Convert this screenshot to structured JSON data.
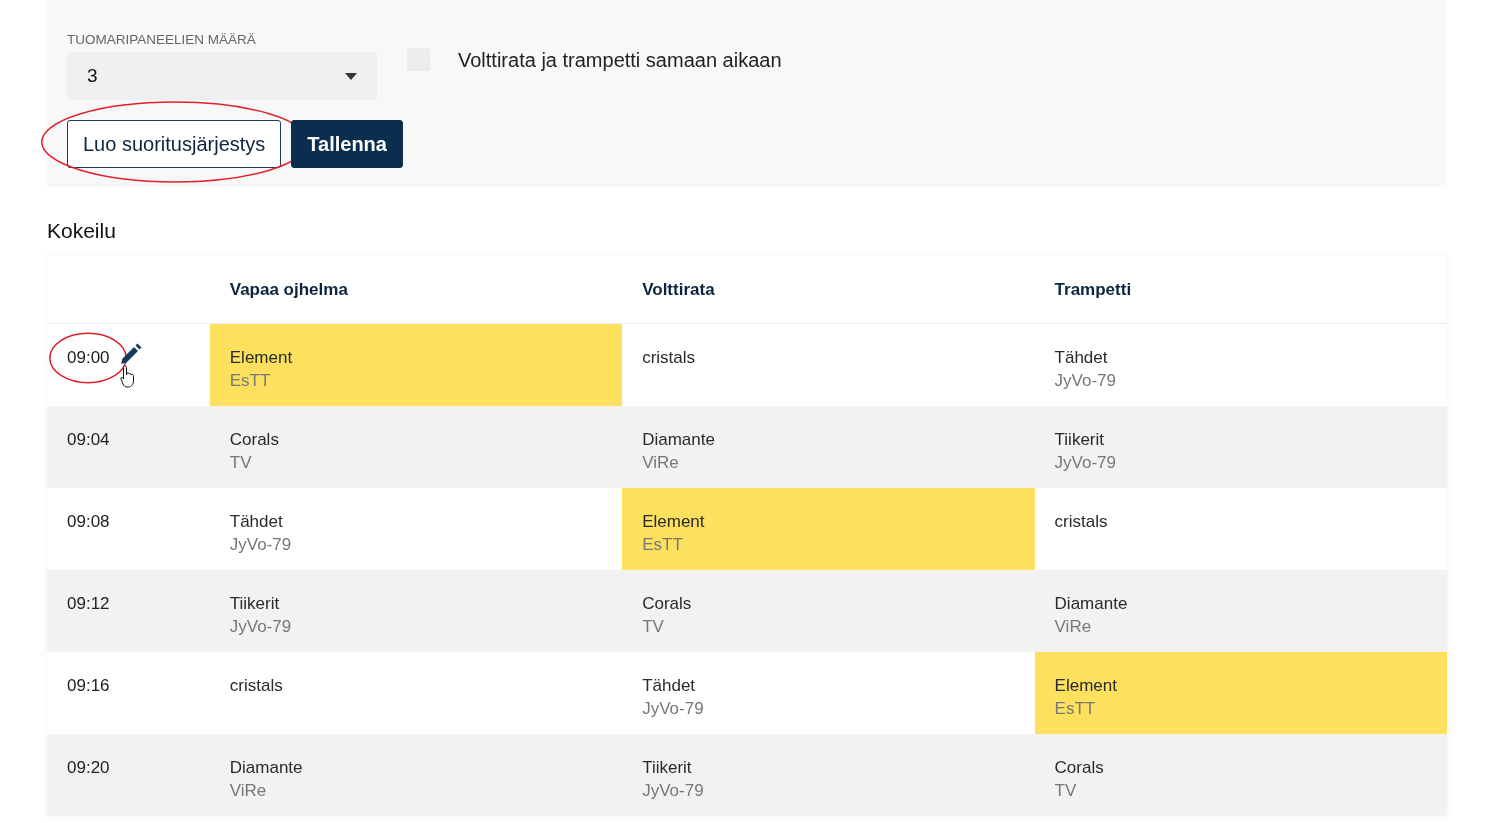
{
  "settings": {
    "judge_panels": {
      "label": "TUOMARIPANEELIEN MÄÄRÄ",
      "value": "3"
    },
    "simultaneous": {
      "label": "Volttirata ja trampetti samaan aikaan",
      "checked": false
    },
    "buttons": [
      {
        "label": "Luo suoritusjärjestys",
        "kind": "outline",
        "circled": true
      },
      {
        "label": "Tallenna",
        "kind": "primary",
        "circled": false
      }
    ]
  },
  "section_title": "Kokeilu",
  "table": {
    "columns": [
      "Vapaa ojhelma",
      "Volttirata",
      "Trampetti"
    ],
    "rows": [
      {
        "time": "09:00",
        "editable": true,
        "circled": true,
        "hovered": true,
        "cells": [
          {
            "team": "Element",
            "club": "EsTT",
            "highlighted": true
          },
          {
            "team": "cristals",
            "highlighted": false
          },
          {
            "team": "Tähdet",
            "club": "JyVo-79",
            "highlighted": false
          }
        ]
      },
      {
        "time": "09:04",
        "editable": false,
        "circled": false,
        "hovered": false,
        "cells": [
          {
            "team": "Corals",
            "club": "TV",
            "highlighted": false
          },
          {
            "team": "Diamante",
            "club": "ViRe",
            "highlighted": false
          },
          {
            "team": "Tiikerit",
            "club": "JyVo-79",
            "highlighted": false
          }
        ]
      },
      {
        "time": "09:08",
        "editable": false,
        "circled": false,
        "hovered": false,
        "cells": [
          {
            "team": "Tähdet",
            "club": "JyVo-79",
            "highlighted": false
          },
          {
            "team": "Element",
            "club": "EsTT",
            "highlighted": true
          },
          {
            "team": "cristals",
            "highlighted": false
          }
        ]
      },
      {
        "time": "09:12",
        "editable": false,
        "circled": false,
        "hovered": false,
        "cells": [
          {
            "team": "Tiikerit",
            "club": "JyVo-79",
            "highlighted": false
          },
          {
            "team": "Corals",
            "club": "TV",
            "highlighted": false
          },
          {
            "team": "Diamante",
            "club": "ViRe",
            "highlighted": false
          }
        ]
      },
      {
        "time": "09:16",
        "editable": false,
        "circled": false,
        "hovered": false,
        "cells": [
          {
            "team": "cristals",
            "highlighted": false
          },
          {
            "team": "Tähdet",
            "club": "JyVo-79",
            "highlighted": false
          },
          {
            "team": "Element",
            "club": "EsTT",
            "highlighted": true
          }
        ]
      },
      {
        "time": "09:20",
        "editable": false,
        "circled": false,
        "hovered": false,
        "cells": [
          {
            "team": "Diamante",
            "club": "ViRe",
            "highlighted": false
          },
          {
            "team": "Tiikerit",
            "club": "JyVo-79",
            "highlighted": false
          },
          {
            "team": "Corals",
            "club": "TV",
            "highlighted": false
          }
        ]
      }
    ]
  }
}
